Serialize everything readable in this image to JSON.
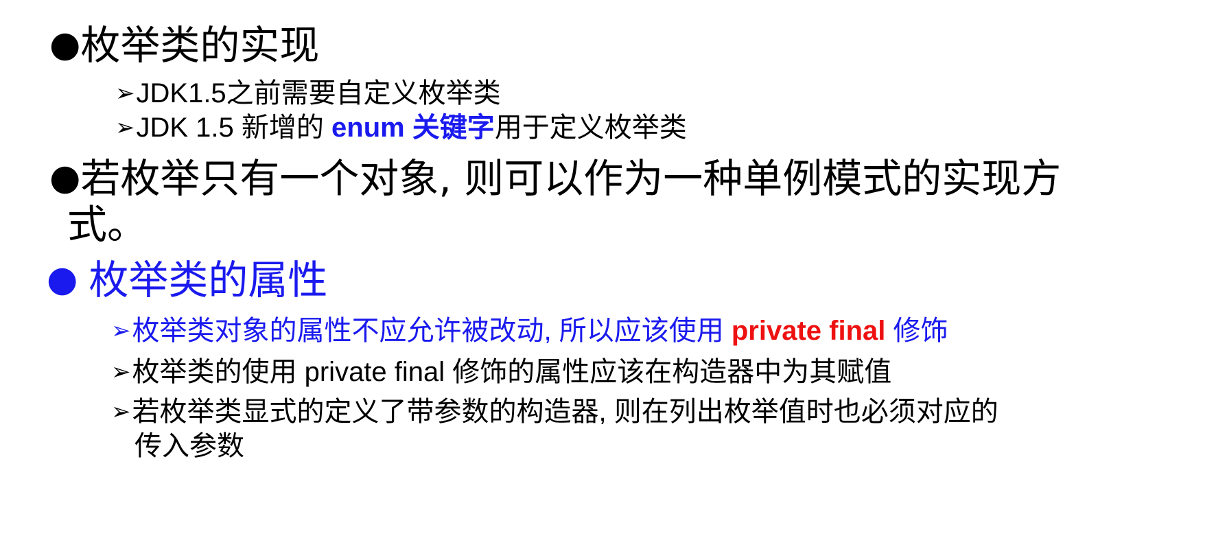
{
  "section1": {
    "heading": "枚举类的实现",
    "items": [
      {
        "text": "JDK1.5之前需要自定义枚举类"
      },
      {
        "prefix": "JDK 1.5 新增的 ",
        "highlight": "enum 关键字",
        "suffix": "用于定义枚举类"
      }
    ]
  },
  "section2": {
    "line1": "若枚举只有一个对象, 则可以作为一种单例模式的实现方",
    "line2": "式。"
  },
  "section3": {
    "heading": "枚举类的属性",
    "items": [
      {
        "prefix": "枚举类对象的属性不应允许被改动, 所以应该使用 ",
        "highlight": "private final",
        "suffix": " 修饰"
      },
      {
        "text": "枚举类的使用 private final 修饰的属性应该在构造器中为其赋值"
      },
      {
        "line1": "若枚举类显式的定义了带参数的构造器, 则在列出枚举值时也必须对应的",
        "line2": "传入参数"
      }
    ]
  },
  "glyphs": {
    "bullet": "●",
    "arrow": "➢"
  },
  "colors": {
    "text": "#000000",
    "accent_blue": "#1a1aee",
    "accent_red": "#ee1111"
  }
}
